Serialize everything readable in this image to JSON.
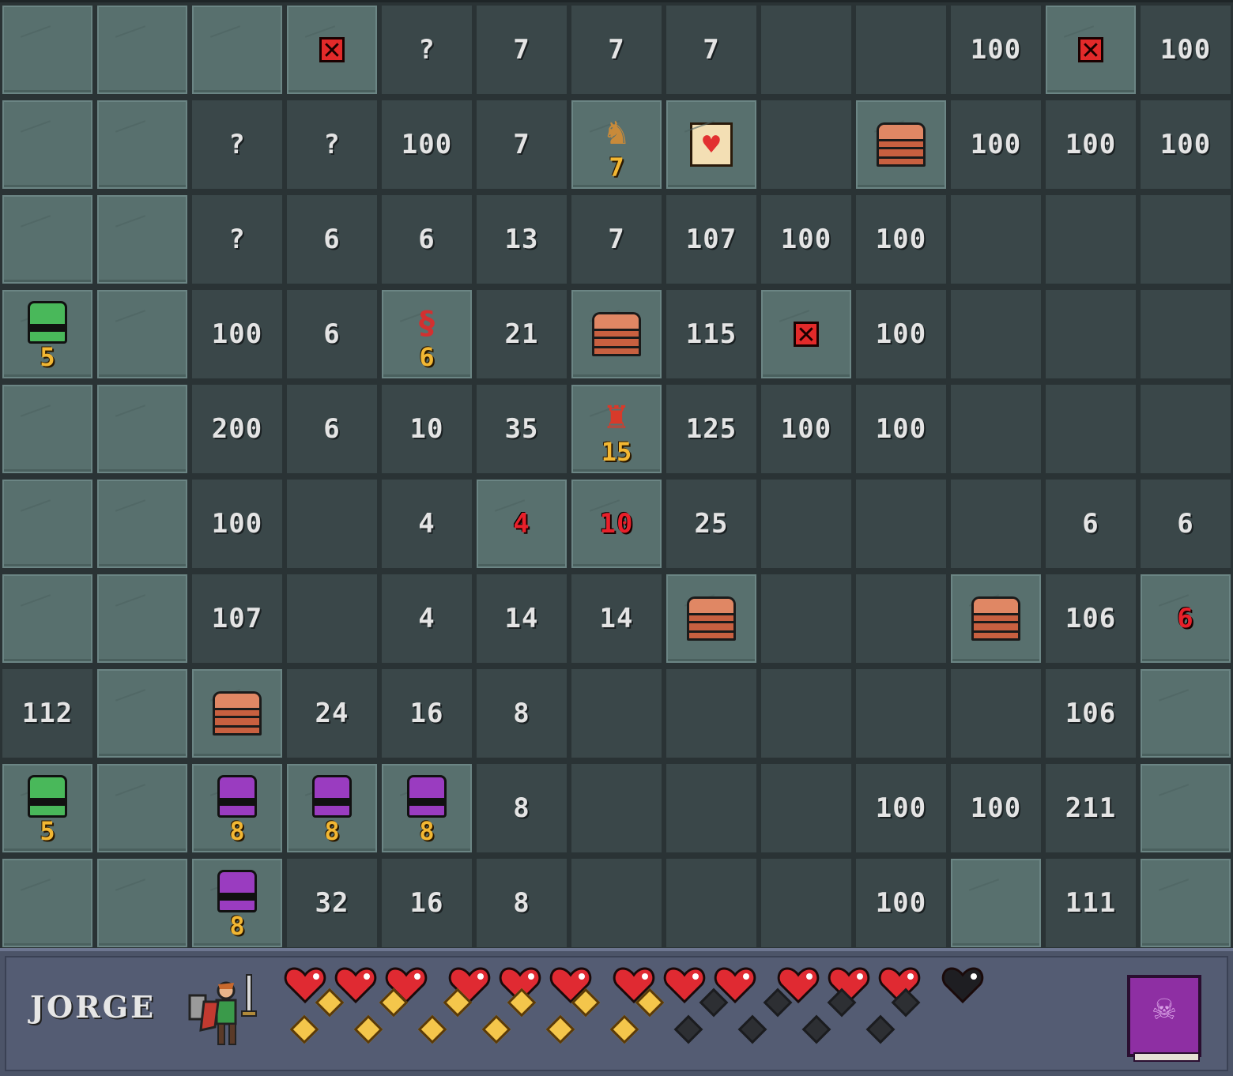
{
  "board": {
    "cols": 13,
    "rows": 10,
    "cells": [
      [
        {
          "t": "hidden"
        },
        {
          "t": "hidden"
        },
        {
          "t": "hidden"
        },
        {
          "t": "x"
        },
        {
          "t": "num",
          "v": "?"
        },
        {
          "t": "num",
          "v": "7"
        },
        {
          "t": "num",
          "v": "7"
        },
        {
          "t": "num",
          "v": "7"
        },
        {
          "t": "empty"
        },
        {
          "t": "empty"
        },
        {
          "t": "num",
          "v": "100"
        },
        {
          "t": "x"
        },
        {
          "t": "num",
          "v": "100"
        }
      ],
      [
        {
          "t": "hidden"
        },
        {
          "t": "hidden"
        },
        {
          "t": "num",
          "v": "?"
        },
        {
          "t": "num",
          "v": "?"
        },
        {
          "t": "num",
          "v": "100"
        },
        {
          "t": "num",
          "v": "7"
        },
        {
          "t": "monster",
          "kind": "goblin",
          "level": "7"
        },
        {
          "t": "scroll"
        },
        {
          "t": "empty"
        },
        {
          "t": "wall"
        },
        {
          "t": "num",
          "v": "100"
        },
        {
          "t": "num",
          "v": "100"
        },
        {
          "t": "num",
          "v": "100"
        }
      ],
      [
        {
          "t": "hidden"
        },
        {
          "t": "hidden"
        },
        {
          "t": "num",
          "v": "?"
        },
        {
          "t": "num",
          "v": "6"
        },
        {
          "t": "num",
          "v": "6"
        },
        {
          "t": "num",
          "v": "13"
        },
        {
          "t": "num",
          "v": "7"
        },
        {
          "t": "num",
          "v": "107"
        },
        {
          "t": "num",
          "v": "100"
        },
        {
          "t": "num",
          "v": "100"
        },
        {
          "t": "empty"
        },
        {
          "t": "empty"
        },
        {
          "t": "empty"
        }
      ],
      [
        {
          "t": "chest",
          "color": "green",
          "level": "5"
        },
        {
          "t": "hidden"
        },
        {
          "t": "num",
          "v": "100"
        },
        {
          "t": "num",
          "v": "6"
        },
        {
          "t": "monster",
          "kind": "snake",
          "level": "6"
        },
        {
          "t": "num",
          "v": "21"
        },
        {
          "t": "wall"
        },
        {
          "t": "num",
          "v": "115"
        },
        {
          "t": "x"
        },
        {
          "t": "num",
          "v": "100"
        },
        {
          "t": "empty"
        },
        {
          "t": "empty"
        },
        {
          "t": "empty"
        }
      ],
      [
        {
          "t": "hidden"
        },
        {
          "t": "hidden"
        },
        {
          "t": "num",
          "v": "200"
        },
        {
          "t": "num",
          "v": "6"
        },
        {
          "t": "num",
          "v": "10"
        },
        {
          "t": "num",
          "v": "35"
        },
        {
          "t": "monster",
          "kind": "dragon",
          "level": "15"
        },
        {
          "t": "num",
          "v": "125"
        },
        {
          "t": "num",
          "v": "100"
        },
        {
          "t": "num",
          "v": "100"
        },
        {
          "t": "empty"
        },
        {
          "t": "empty"
        },
        {
          "t": "empty"
        }
      ],
      [
        {
          "t": "hidden"
        },
        {
          "t": "hidden"
        },
        {
          "t": "num",
          "v": "100"
        },
        {
          "t": "empty"
        },
        {
          "t": "num",
          "v": "4"
        },
        {
          "t": "rednum",
          "v": "4"
        },
        {
          "t": "rednum",
          "v": "10"
        },
        {
          "t": "num",
          "v": "25"
        },
        {
          "t": "empty"
        },
        {
          "t": "empty"
        },
        {
          "t": "empty"
        },
        {
          "t": "num",
          "v": "6"
        },
        {
          "t": "num",
          "v": "6"
        }
      ],
      [
        {
          "t": "hidden"
        },
        {
          "t": "hidden"
        },
        {
          "t": "num",
          "v": "107"
        },
        {
          "t": "empty"
        },
        {
          "t": "num",
          "v": "4"
        },
        {
          "t": "num",
          "v": "14"
        },
        {
          "t": "num",
          "v": "14"
        },
        {
          "t": "wall"
        },
        {
          "t": "empty"
        },
        {
          "t": "empty"
        },
        {
          "t": "wall"
        },
        {
          "t": "num",
          "v": "106"
        },
        {
          "t": "rednum",
          "v": "6"
        }
      ],
      [
        {
          "t": "num",
          "v": "112"
        },
        {
          "t": "hidden"
        },
        {
          "t": "wall"
        },
        {
          "t": "num",
          "v": "24"
        },
        {
          "t": "num",
          "v": "16"
        },
        {
          "t": "num",
          "v": "8"
        },
        {
          "t": "empty"
        },
        {
          "t": "empty"
        },
        {
          "t": "empty"
        },
        {
          "t": "empty"
        },
        {
          "t": "empty"
        },
        {
          "t": "num",
          "v": "106"
        },
        {
          "t": "hidden"
        }
      ],
      [
        {
          "t": "chest",
          "color": "green",
          "level": "5"
        },
        {
          "t": "hidden"
        },
        {
          "t": "chest",
          "color": "purple",
          "level": "8"
        },
        {
          "t": "chest",
          "color": "purple",
          "level": "8"
        },
        {
          "t": "chest",
          "color": "purple",
          "level": "8"
        },
        {
          "t": "num",
          "v": "8"
        },
        {
          "t": "empty"
        },
        {
          "t": "empty"
        },
        {
          "t": "empty"
        },
        {
          "t": "num",
          "v": "100"
        },
        {
          "t": "num",
          "v": "100"
        },
        {
          "t": "num",
          "v": "211"
        },
        {
          "t": "hidden"
        }
      ],
      [
        {
          "t": "hidden"
        },
        {
          "t": "hidden"
        },
        {
          "t": "chest",
          "color": "purple",
          "level": "8"
        },
        {
          "t": "num",
          "v": "32"
        },
        {
          "t": "num",
          "v": "16"
        },
        {
          "t": "num",
          "v": "8"
        },
        {
          "t": "empty"
        },
        {
          "t": "empty"
        },
        {
          "t": "empty"
        },
        {
          "t": "num",
          "v": "100"
        },
        {
          "t": "hidden"
        },
        {
          "t": "num",
          "v": "111"
        },
        {
          "t": "hidden"
        }
      ]
    ]
  },
  "hud": {
    "player_name": "JORGE",
    "hearts_full": 12,
    "hearts_total": 13,
    "gems_full": 12,
    "gems_total": 20,
    "colors": {
      "heart": "#e02a32",
      "heart_empty": "#1e1e22",
      "gem": "#f4c64b",
      "gem_empty": "#2d2f33",
      "spellbook": "#8e2fa3"
    },
    "icons": {
      "player": "knight-sprite-icon",
      "spellbook": "spellbook-icon"
    }
  }
}
